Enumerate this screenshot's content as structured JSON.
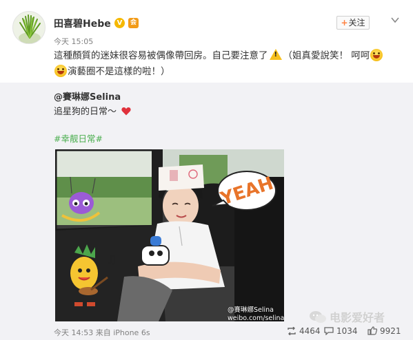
{
  "post": {
    "username": "田喜碧Hebe",
    "verified_mark": "V",
    "member_mark": "会",
    "follow_plus": "+",
    "follow_label": "关注",
    "time": "今天 15:05",
    "text_line1": "這種顏質的迷妹很容易被偶像帶回房。自己要注意了",
    "text_line1_tail": "（姐真愛說笑！ 呵呵",
    "text_line2": "演藝圈不是這樣的啦！）",
    "warning_mark": "!"
  },
  "retweet": {
    "author": "@賽琳娜Selina",
    "text": "追星狗的日常～",
    "hashtag": "#幸靓日常#",
    "photo": {
      "sticker_text": "YEAH",
      "music_note": "♫",
      "watermark_line1": "@賽琳娜Selina",
      "watermark_line2": "weibo.com/selinashe"
    }
  },
  "footer": {
    "time": "今天 14:53",
    "source": "来自 iPhone 6s",
    "retweet_count": "4464",
    "comment_count": "1034",
    "like_count": "9921"
  },
  "overlay": {
    "account_name": "电影爱好者"
  },
  "colors": {
    "accent_orange": "#ff8140",
    "hashtag_green": "#4caf50",
    "heart_red": "#e0313b",
    "badge_yellow": "#f5b800"
  }
}
